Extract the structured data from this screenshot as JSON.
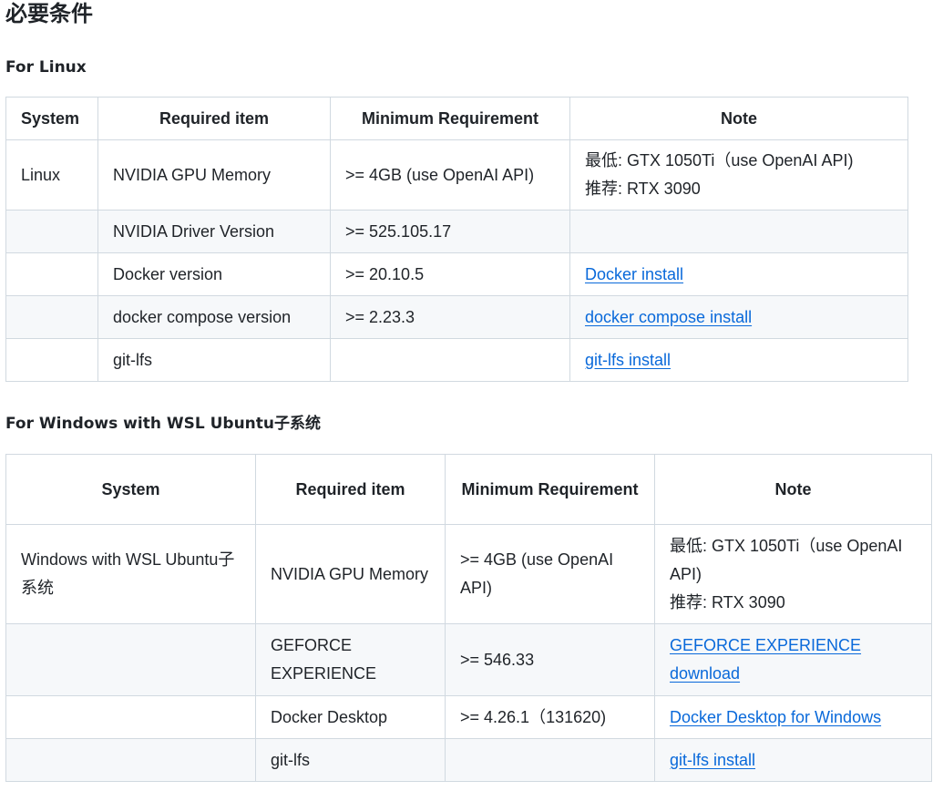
{
  "heading": "必要条件",
  "sections": [
    {
      "title": "For Linux",
      "columns": [
        "System",
        "Required item",
        "Minimum Requirement",
        "Note"
      ],
      "rows": [
        {
          "system": "Linux",
          "item": "NVIDIA GPU Memory",
          "min": ">= 4GB (use OpenAI API)",
          "note_line1": "最低: GTX 1050Ti（use OpenAI API)",
          "note_line2": "推荐: RTX 3090"
        },
        {
          "system": "",
          "item": "NVIDIA Driver Version",
          "min": ">= 525.105.17",
          "note": ""
        },
        {
          "system": "",
          "item": "Docker version",
          "min": ">= 20.10.5",
          "note_link": "Docker install"
        },
        {
          "system": "",
          "item": "docker compose version",
          "min": ">= 2.23.3",
          "note_link": "docker compose install"
        },
        {
          "system": "",
          "item": "git-lfs",
          "min": "",
          "note_link": "git-lfs install"
        }
      ]
    },
    {
      "title": "For Windows with WSL Ubuntu子系统",
      "columns": [
        "System",
        "Required item",
        "Minimum Requirement",
        "Note"
      ],
      "rows": [
        {
          "system": "Windows with WSL Ubuntu子系统",
          "item": "NVIDIA GPU Memory",
          "min": ">= 4GB (use OpenAI API)",
          "note_line1": "最低: GTX 1050Ti（use OpenAI API)",
          "note_line2": "推荐: RTX 3090"
        },
        {
          "system": "",
          "item": "GEFORCE EXPERIENCE",
          "min": ">= 546.33",
          "note_link": "GEFORCE EXPERIENCE download"
        },
        {
          "system": "",
          "item": "Docker Desktop",
          "min": ">= 4.26.1（131620)",
          "note_link": "Docker Desktop for Windows"
        },
        {
          "system": "",
          "item": "git-lfs",
          "min": "",
          "note_link": "git-lfs install"
        }
      ]
    }
  ]
}
